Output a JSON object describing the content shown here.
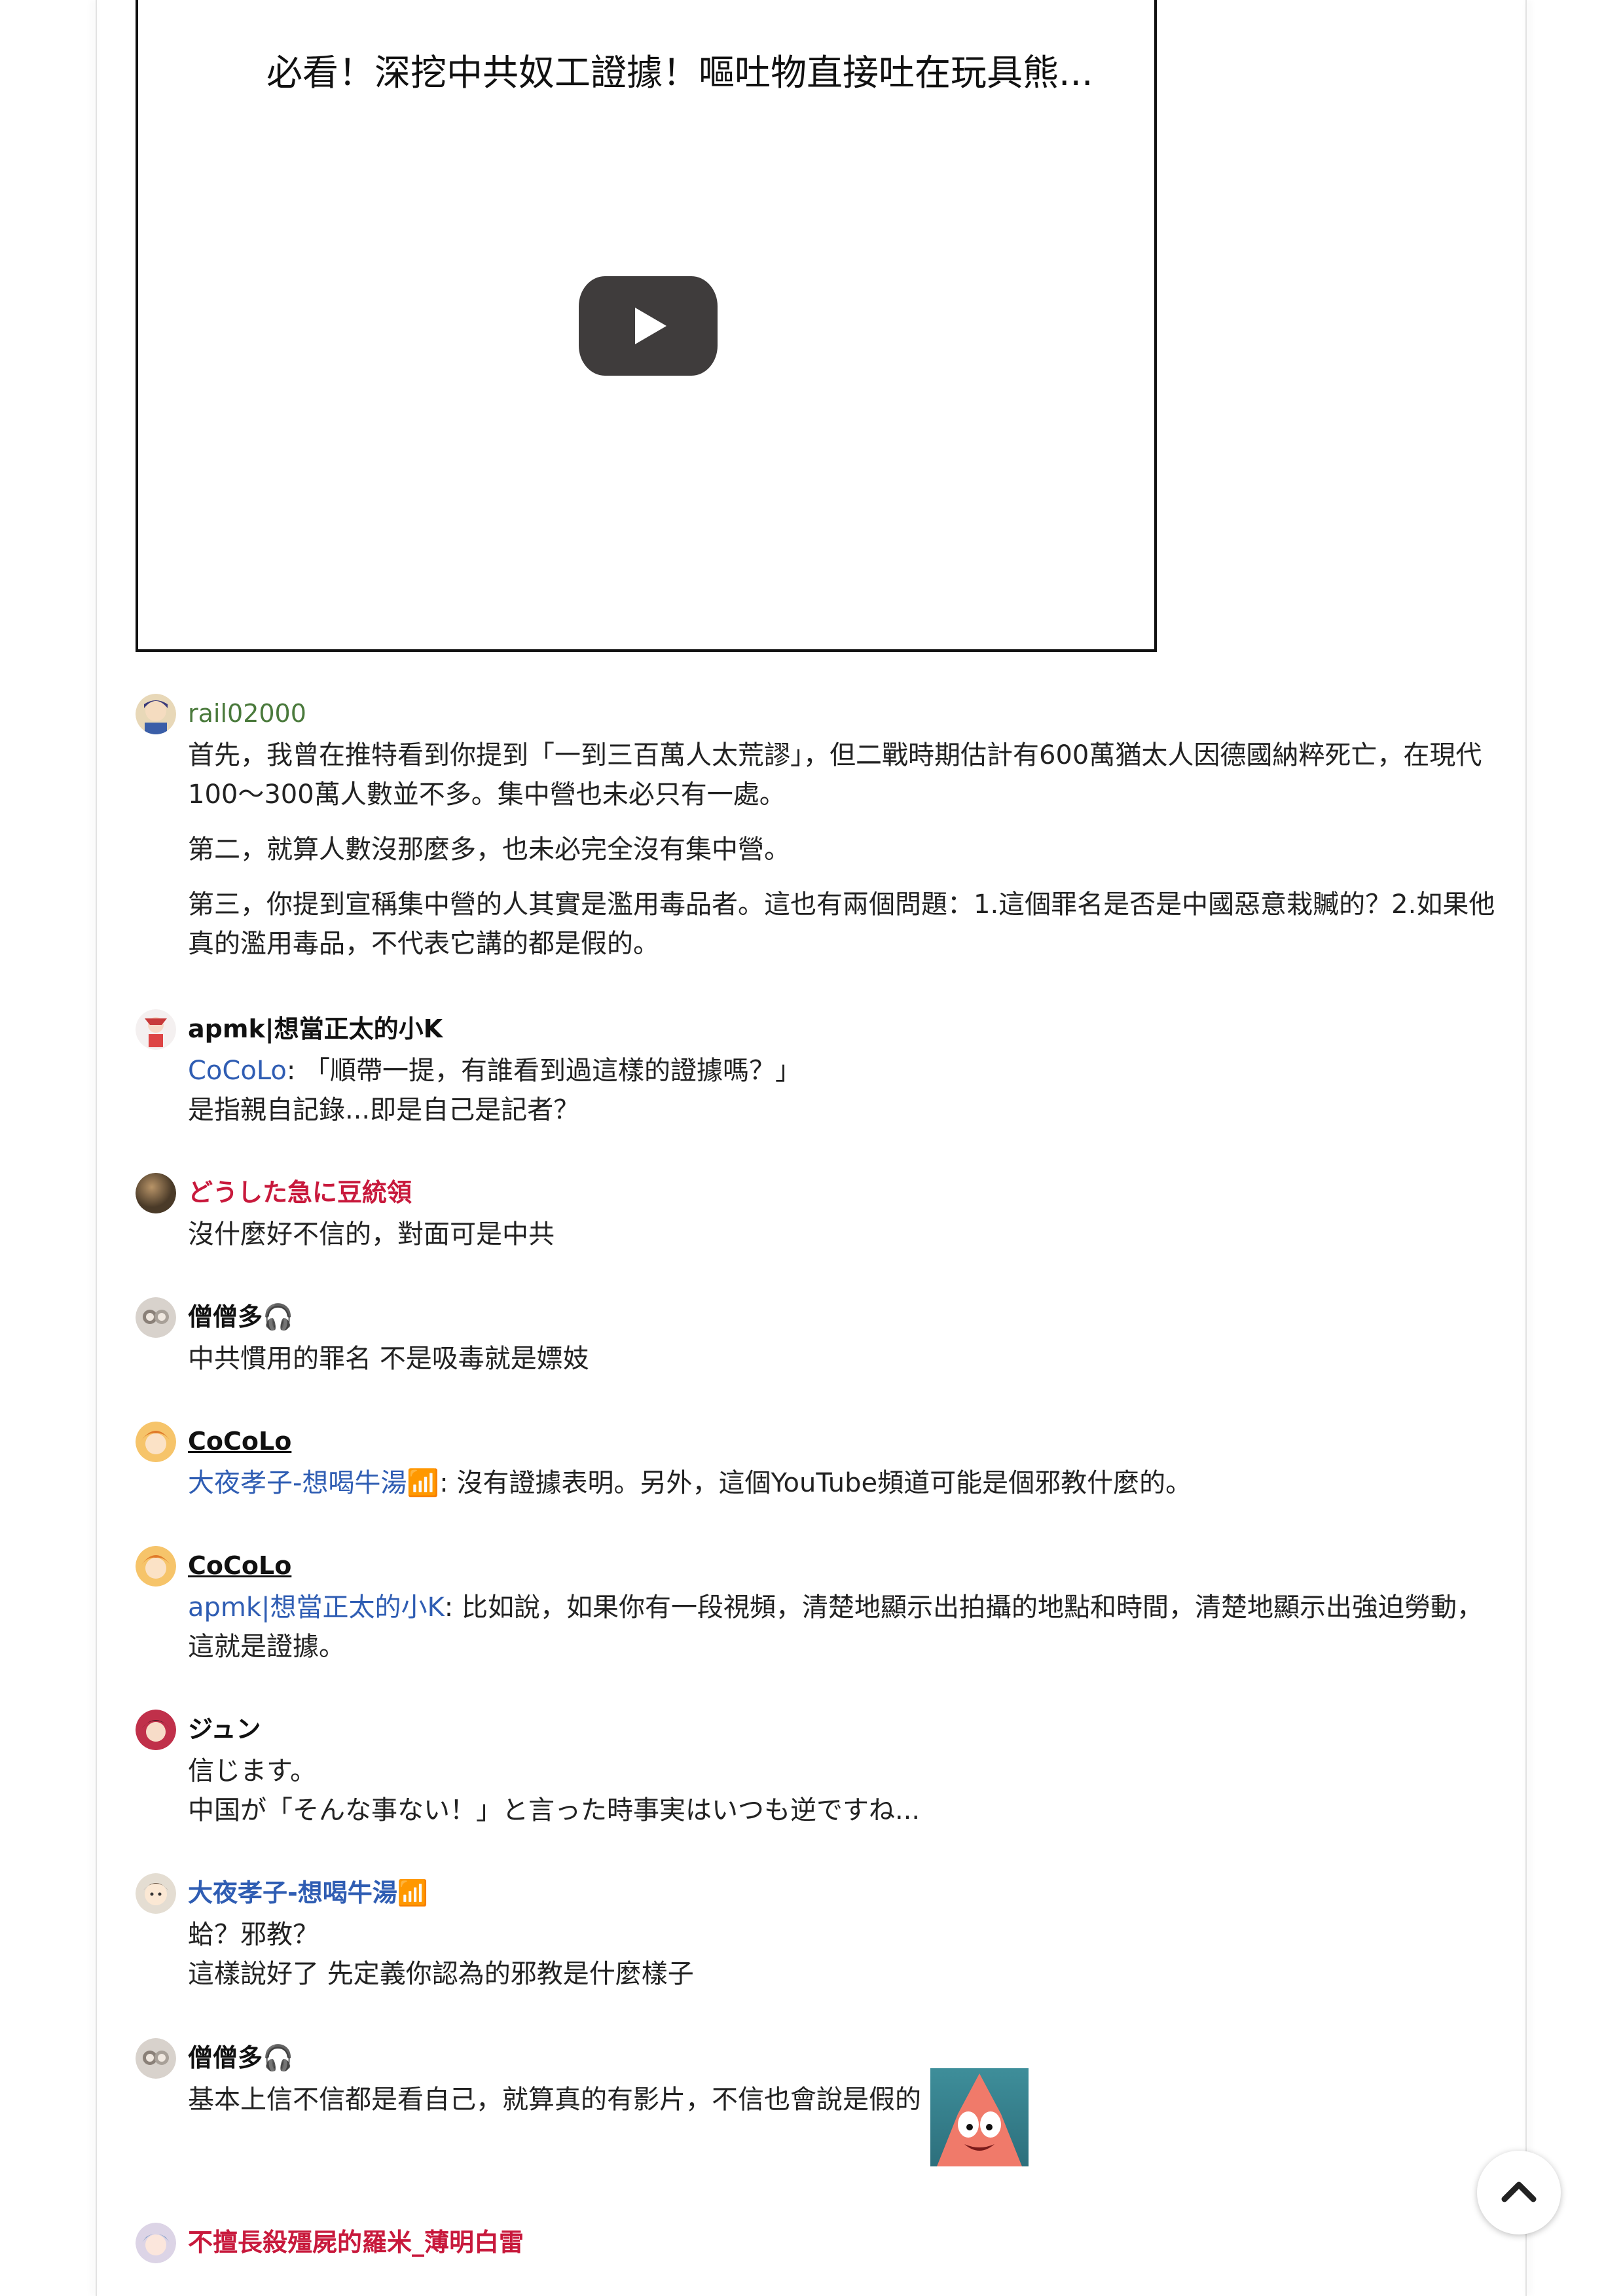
{
  "video": {
    "title": "必看！深挖中共奴工證據！嘔吐物直接吐在玩具熊..."
  },
  "comments": [
    {
      "user": "rail02000",
      "lines": [
        "首先，我曾在推特看到你提到「一到三百萬人太荒謬」，但二戰時期估計有600萬猶太人因德國納粹死亡，在現代100～300萬人數並不多。集中營也未必只有一處。",
        "第二，就算人數沒那麼多，也未必完全沒有集中營。",
        "第三，你提到宣稱集中營的人其實是濫用毒品者。這也有兩個問題：1.這個罪名是否是中國惡意栽贓的？2.如果他真的濫用毒品，不代表它講的都是假的。"
      ]
    },
    {
      "user": "apmk|想當正太的小K",
      "mention": "CoCoLo",
      "lines": [
        ": 「順帶一提，有誰看到過這樣的證據嗎？」",
        "是指親自記錄...即是自己是記者？"
      ]
    },
    {
      "user": "どうした急に豆統領",
      "lines": [
        "沒什麼好不信的，對面可是中共"
      ]
    },
    {
      "user": "僧僧多🎧",
      "lines": [
        "中共慣用的罪名 不是吸毒就是嫖妓"
      ]
    },
    {
      "user": "CoCoLo",
      "mention": "大夜孝子-想喝牛湯📶",
      "lines": [
        ": 沒有證據表明。另外，這個YouTube頻道可能是個邪教什麼的。"
      ]
    },
    {
      "user": "CoCoLo",
      "mention": "apmk|想當正太的小K",
      "lines": [
        ": 比如說，如果你有一段視頻，清楚地顯示出拍攝的地點和時間，清楚地顯示出強迫勞動，這就是證據。"
      ]
    },
    {
      "user": "ジュン",
      "lines": [
        "信じます。",
        "中国が「そんな事ない！」と言った時事実はいつも逆ですね..."
      ]
    },
    {
      "user": "大夜孝子-想喝牛湯📶",
      "lines": [
        "蛤？邪教？",
        "這樣說好了 先定義你認為的邪教是什麼樣子"
      ]
    },
    {
      "user": "僧僧多🎧",
      "lines": [
        "基本上信不信都是看自己，就算真的有影片，不信也會說是假的"
      ]
    },
    {
      "user": "不擅長殺殭屍的羅米_薄明白雷",
      "lines": []
    }
  ],
  "icons": {
    "play": "youtube-play-icon",
    "scroll_top": "chevron-up-icon",
    "sticker": "patrick-star-sticker"
  },
  "colors": {
    "mention": "#2f5db3",
    "green_user": "#4a7a3c",
    "red_user": "#c8193c"
  }
}
